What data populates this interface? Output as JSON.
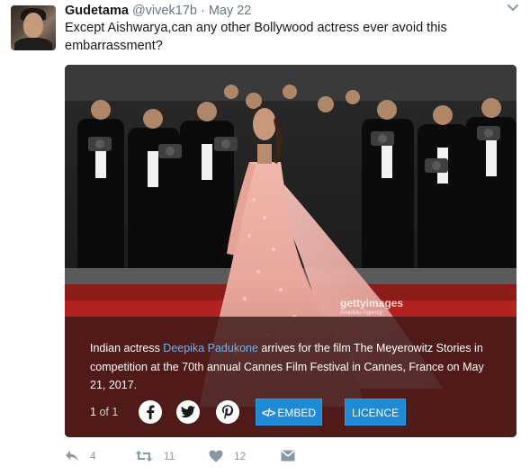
{
  "tweet": {
    "name": "Gudetama",
    "handle": "@vivek17b",
    "separator": "·",
    "date": "May 22",
    "text": "Except Aishwarya,can any other Bollywood actress ever avoid this embarrassment?"
  },
  "media": {
    "caption_prefix": "Indian actress ",
    "caption_link": "Deepika Padukone",
    "caption_suffix": " arrives for the film The Meyerowitz Stories in competition at the 70th annual Cannes Film Festival in Cannes, France on May 21, 2017.",
    "counter_current": "1",
    "counter_of": "of 1",
    "embed_code": "</>",
    "embed_label": "EMBED",
    "licence_label": "LICENCE",
    "watermark": "gettyimages",
    "watermark_sub": "Anadolu Agency",
    "share_icons": [
      "facebook-icon",
      "twitter-icon",
      "pinterest-icon"
    ]
  },
  "actions": {
    "reply_count": "4",
    "retweet_count": "11",
    "like_count": "12"
  },
  "colors": {
    "link_blue": "#6fb4ec",
    "button_blue": "#1f8ad6",
    "action_gray": "#8899a6",
    "gown_pink": "#e8a69c",
    "carpet_red": "#b2231f"
  }
}
